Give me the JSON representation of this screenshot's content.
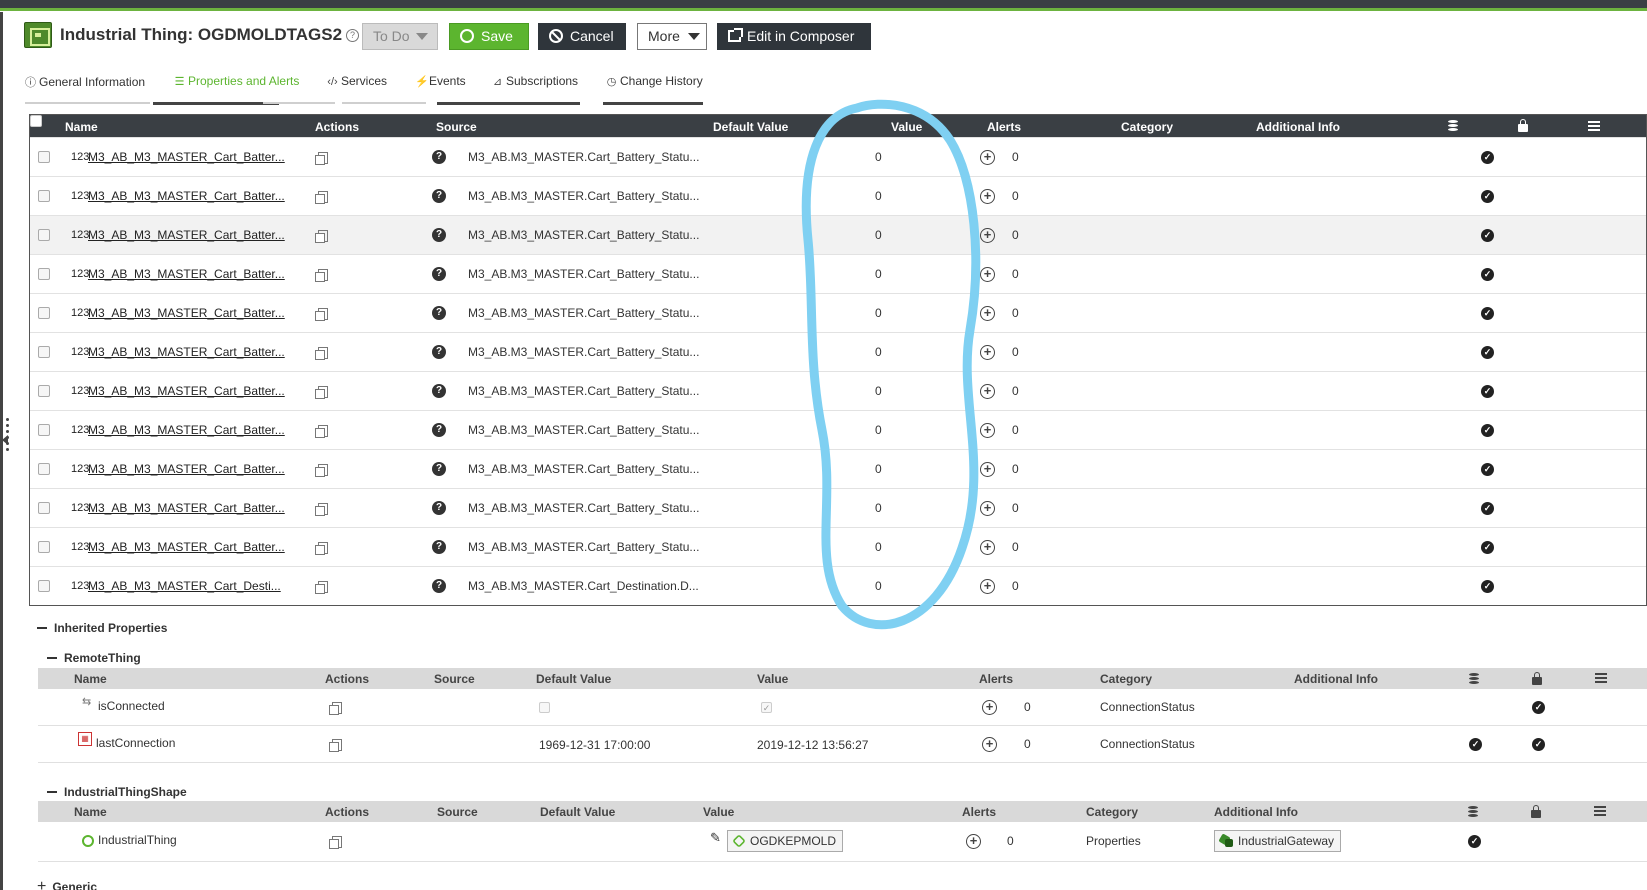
{
  "header": {
    "title": "Industrial Thing: OGDMOLDTAGS2",
    "todo_label": "To Do",
    "save_label": "Save",
    "cancel_label": "Cancel",
    "more_label": "More",
    "composer_label": "Edit in Composer"
  },
  "tabs": [
    {
      "label": "General Information",
      "icon": "info-icon"
    },
    {
      "label": "Properties and Alerts",
      "icon": "list-icon"
    },
    {
      "label": "Services",
      "icon": "code-icon"
    },
    {
      "label": "Events",
      "icon": "bolt-icon"
    },
    {
      "label": "Subscriptions",
      "icon": "rss-icon"
    },
    {
      "label": "Change History",
      "icon": "history-icon"
    }
  ],
  "grid": {
    "columns": {
      "name": "Name",
      "actions": "Actions",
      "source": "Source",
      "default_value": "Default Value",
      "value": "Value",
      "alerts": "Alerts",
      "category": "Category",
      "additional_info": "Additional Info"
    },
    "type_badge": "123",
    "rows": [
      {
        "name": "M3_AB_M3_MASTER_Cart_Batter...",
        "source": "M3_AB.M3_MASTER.Cart_Battery_Statu...",
        "value": "0",
        "alerts": "0"
      },
      {
        "name": "M3_AB_M3_MASTER_Cart_Batter...",
        "source": "M3_AB.M3_MASTER.Cart_Battery_Statu...",
        "value": "0",
        "alerts": "0"
      },
      {
        "name": "M3_AB_M3_MASTER_Cart_Batter...",
        "source": "M3_AB.M3_MASTER.Cart_Battery_Statu...",
        "value": "0",
        "alerts": "0"
      },
      {
        "name": "M3_AB_M3_MASTER_Cart_Batter...",
        "source": "M3_AB.M3_MASTER.Cart_Battery_Statu...",
        "value": "0",
        "alerts": "0"
      },
      {
        "name": "M3_AB_M3_MASTER_Cart_Batter...",
        "source": "M3_AB.M3_MASTER.Cart_Battery_Statu...",
        "value": "0",
        "alerts": "0"
      },
      {
        "name": "M3_AB_M3_MASTER_Cart_Batter...",
        "source": "M3_AB.M3_MASTER.Cart_Battery_Statu...",
        "value": "0",
        "alerts": "0"
      },
      {
        "name": "M3_AB_M3_MASTER_Cart_Batter...",
        "source": "M3_AB.M3_MASTER.Cart_Battery_Statu...",
        "value": "0",
        "alerts": "0"
      },
      {
        "name": "M3_AB_M3_MASTER_Cart_Batter...",
        "source": "M3_AB.M3_MASTER.Cart_Battery_Statu...",
        "value": "0",
        "alerts": "0"
      },
      {
        "name": "M3_AB_M3_MASTER_Cart_Batter...",
        "source": "M3_AB.M3_MASTER.Cart_Battery_Statu...",
        "value": "0",
        "alerts": "0"
      },
      {
        "name": "M3_AB_M3_MASTER_Cart_Batter...",
        "source": "M3_AB.M3_MASTER.Cart_Battery_Statu...",
        "value": "0",
        "alerts": "0"
      },
      {
        "name": "M3_AB_M3_MASTER_Cart_Batter...",
        "source": "M3_AB.M3_MASTER.Cart_Battery_Statu...",
        "value": "0",
        "alerts": "0"
      },
      {
        "name": "M3_AB_M3_MASTER_Cart_Desti...",
        "source": "M3_AB.M3_MASTER.Cart_Destination.D...",
        "value": "0",
        "alerts": "0"
      }
    ]
  },
  "inherited": {
    "title": "Inherited Properties",
    "remote_thing": {
      "title": "RemoteThing",
      "columns": {
        "name": "Name",
        "actions": "Actions",
        "source": "Source",
        "default_value": "Default Value",
        "value": "Value",
        "alerts": "Alerts",
        "category": "Category",
        "additional_info": "Additional Info"
      },
      "rows": [
        {
          "name": "isConnected",
          "default_value": "",
          "value": "",
          "alerts": "0",
          "category": "ConnectionStatus"
        },
        {
          "name": "lastConnection",
          "default_value": "1969-12-31 17:00:00",
          "value": "2019-12-12 13:56:27",
          "alerts": "0",
          "category": "ConnectionStatus"
        }
      ]
    },
    "shape": {
      "title": "IndustrialThingShape",
      "columns": {
        "name": "Name",
        "actions": "Actions",
        "source": "Source",
        "default_value": "Default Value",
        "value": "Value",
        "alerts": "Alerts",
        "category": "Category",
        "additional_info": "Additional Info"
      },
      "rows": [
        {
          "name": "IndustrialThing",
          "value": "OGDKEPMOLD",
          "alerts": "0",
          "category": "Properties",
          "additional_info": "IndustrialGateway"
        }
      ]
    },
    "generic_title": "Generic"
  },
  "colors": {
    "accent_green": "#5cb52f",
    "header_dark": "#3a3f44",
    "annotation_blue": "#7fd0f2"
  }
}
